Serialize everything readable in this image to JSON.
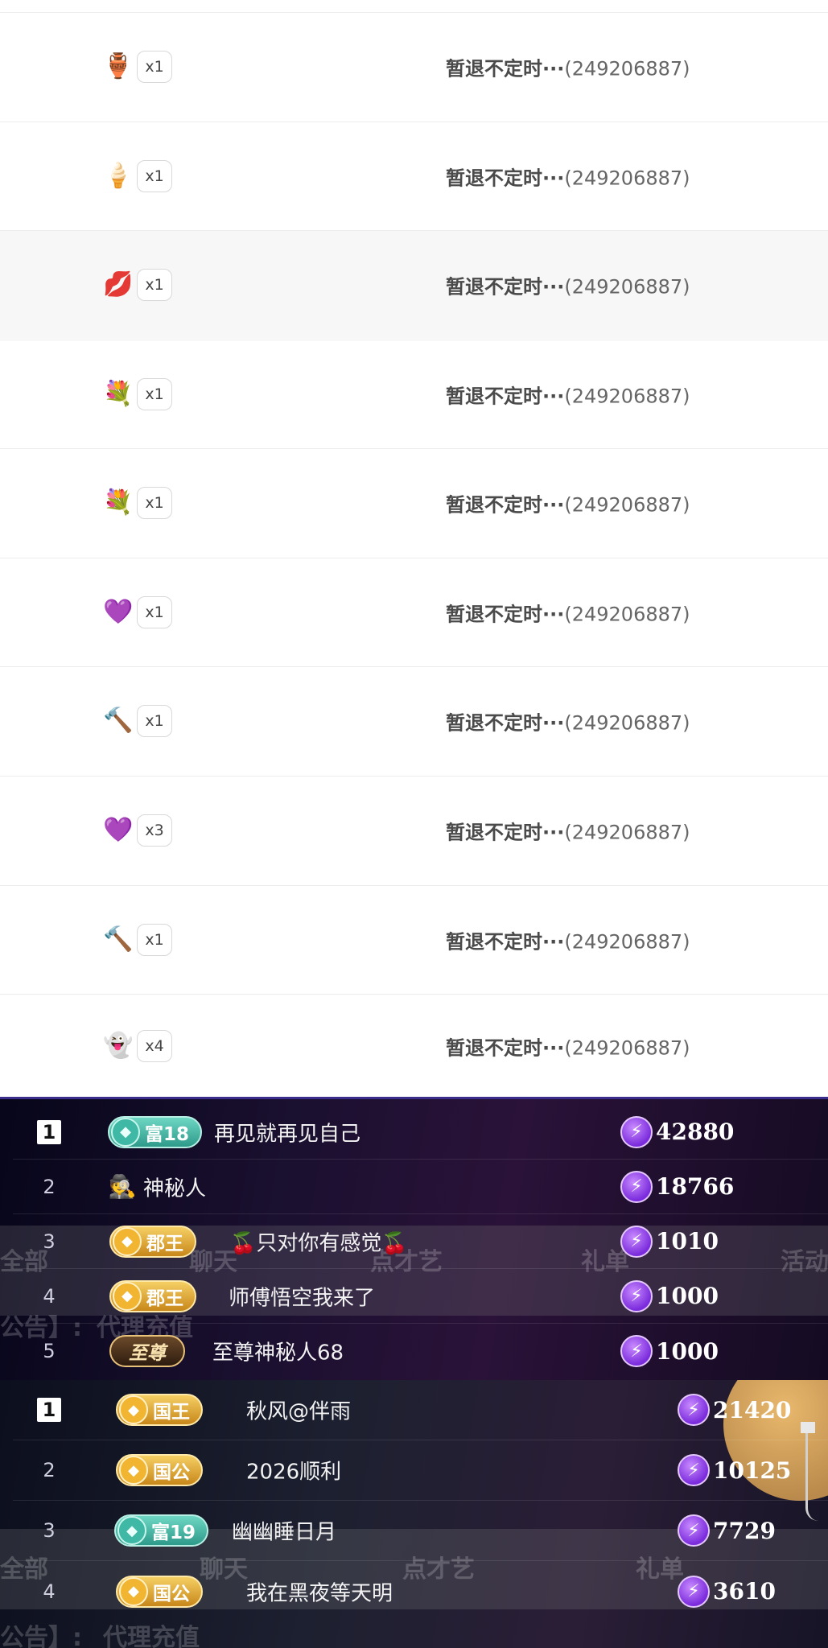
{
  "gift_records": [
    {
      "icon": "perfume-icon",
      "glyph": "🏺",
      "count": "x1",
      "receiver": "暂退不定时···",
      "id": "(249206887)",
      "alt": false
    },
    {
      "icon": "ice-cream-icon",
      "glyph": "🍦",
      "count": "x1",
      "receiver": "暂退不定时···",
      "id": "(249206887)",
      "alt": false
    },
    {
      "icon": "kiss-lips-icon",
      "glyph": "💋",
      "count": "x1",
      "receiver": "暂退不定时···",
      "id": "(249206887)",
      "alt": true
    },
    {
      "icon": "flower-bouquet-icon",
      "glyph": "💐",
      "count": "x1",
      "receiver": "暂退不定时···",
      "id": "(249206887)",
      "alt": false
    },
    {
      "icon": "flower-bouquet-icon",
      "glyph": "💐",
      "count": "x1",
      "receiver": "暂退不定时···",
      "id": "(249206887)",
      "alt": false
    },
    {
      "icon": "heart-gift-icon",
      "glyph": "💜",
      "count": "x1",
      "receiver": "暂退不定时···",
      "id": "(249206887)",
      "alt": false
    },
    {
      "icon": "golden-scepter-icon",
      "glyph": "🔨",
      "count": "x1",
      "receiver": "暂退不定时···",
      "id": "(249206887)",
      "alt": false
    },
    {
      "icon": "heart-gift-icon",
      "glyph": "💜",
      "count": "x3",
      "receiver": "暂退不定时···",
      "id": "(249206887)",
      "alt": false
    },
    {
      "icon": "golden-scepter-icon",
      "glyph": "🔨",
      "count": "x1",
      "receiver": "暂退不定时···",
      "id": "(249206887)",
      "alt": false
    },
    {
      "icon": "ghost-balloon-icon",
      "glyph": "👻",
      "count": "x4",
      "receiver": "暂退不定时···",
      "id": "(249206887)",
      "alt": false
    }
  ],
  "ranking_1": {
    "background_tabs": [
      "全部",
      "聊天",
      "点才艺",
      "礼单",
      "活动"
    ],
    "background_notice": "公告】:",
    "background_button": "代理充值",
    "rows": [
      {
        "rank": "1",
        "badge_type": "rich",
        "badge_text": "富18",
        "name": "再见就再见自己",
        "score": "42880"
      },
      {
        "rank": "2",
        "badge_type": "mystery",
        "badge_text": "",
        "name": "神秘人",
        "score": "18766"
      },
      {
        "rank": "3",
        "badge_type": "noble",
        "badge_text": "郡王",
        "name": "🍒只对你有感觉🍒",
        "score": "1010"
      },
      {
        "rank": "4",
        "badge_type": "noble",
        "badge_text": "郡王",
        "name": "师傅悟空我来了",
        "score": "1000"
      },
      {
        "rank": "5",
        "badge_type": "supreme",
        "badge_text": "至尊",
        "name": "至尊神秘人68",
        "score": "1000"
      }
    ]
  },
  "ranking_2": {
    "background_tabs": [
      "全部",
      "聊天",
      "点才艺",
      "礼单"
    ],
    "background_notice": "公告】:",
    "background_button": "代理充值",
    "rows": [
      {
        "rank": "1",
        "badge_type": "noble",
        "badge_text": "国王",
        "name": "秋风@伴雨",
        "score": "21420"
      },
      {
        "rank": "2",
        "badge_type": "noble",
        "badge_text": "国公",
        "name": "2026顺利",
        "score": "10125"
      },
      {
        "rank": "3",
        "badge_type": "rich",
        "badge_text": "富19",
        "name": "幽幽睡日月",
        "score": "7729"
      },
      {
        "rank": "4",
        "badge_type": "noble",
        "badge_text": "国公",
        "name": "我在黑夜等天明",
        "score": "3610"
      }
    ]
  },
  "colors": {
    "rich_badge": "#3fb8a5",
    "noble_badge": "#f2b532",
    "score_bolt": "#7a2bdc",
    "panel_bg": "#1b1030"
  }
}
